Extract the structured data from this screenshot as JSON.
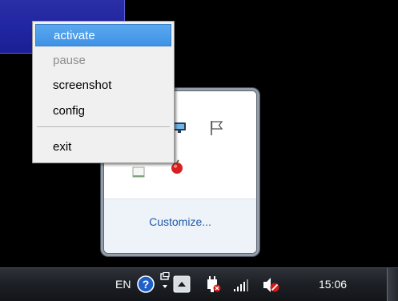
{
  "context_menu": {
    "items": [
      {
        "label": "activate",
        "state": "highlighted"
      },
      {
        "label": "pause",
        "state": "disabled"
      },
      {
        "label": "screenshot",
        "state": "normal"
      },
      {
        "label": "config",
        "state": "normal"
      },
      {
        "label": "exit",
        "state": "normal"
      }
    ]
  },
  "tray_flyout": {
    "customize_label": "Customize...",
    "icons": [
      "network-icon",
      "action-center-flag-icon",
      "tray-app-icon",
      "red-dot-app-icon"
    ]
  },
  "taskbar": {
    "language": "EN",
    "clock": "15:06",
    "icons": [
      "help-icon",
      "touch-pen-icon",
      "show-hidden-icons-button",
      "power-plug-icon",
      "signal-bars-icon",
      "volume-muted-icon"
    ]
  },
  "colors": {
    "menu_highlight": "#3f92e6",
    "link": "#1e5aa8",
    "taskbar": "#1c1f24"
  }
}
